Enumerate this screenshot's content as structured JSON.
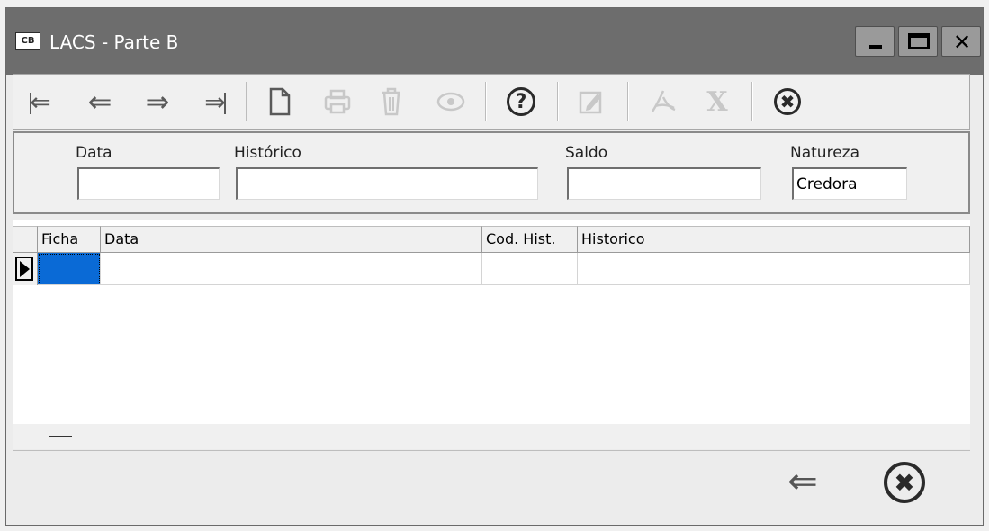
{
  "window": {
    "app_icon_text": "CB",
    "title": "LACS - Parte B",
    "controls": {
      "minimize": "minimize",
      "maximize": "maximize",
      "close_glyph": "✕"
    }
  },
  "toolbar": {
    "buttons": [
      {
        "name": "first-record",
        "icon": "first-arrow-icon",
        "glyph": "⇐",
        "enabled": true
      },
      {
        "name": "previous-record",
        "icon": "left-arrow-icon",
        "glyph": "⇐",
        "enabled": true
      },
      {
        "name": "next-record",
        "icon": "right-arrow-icon",
        "glyph": "⇒",
        "enabled": true
      },
      {
        "name": "last-record",
        "icon": "last-arrow-icon",
        "glyph": "⇒",
        "enabled": true
      },
      {
        "name": "new-record",
        "icon": "new-document-icon",
        "glyph": "🗋",
        "enabled": true
      },
      {
        "name": "print",
        "icon": "printer-icon",
        "glyph": "⎙",
        "enabled": false
      },
      {
        "name": "delete",
        "icon": "trash-icon",
        "glyph": "🗑",
        "enabled": false
      },
      {
        "name": "view",
        "icon": "eye-icon",
        "glyph": "◉",
        "enabled": false
      },
      {
        "name": "help",
        "icon": "help-icon",
        "glyph": "?",
        "enabled": true
      },
      {
        "name": "edit",
        "icon": "edit-icon",
        "glyph": "✎",
        "enabled": false
      },
      {
        "name": "pdf",
        "icon": "pdf-icon",
        "glyph": "⅄",
        "enabled": false
      },
      {
        "name": "excel",
        "icon": "excel-icon",
        "glyph": "X",
        "enabled": false
      },
      {
        "name": "close",
        "icon": "close-circle-icon",
        "glyph": "✖",
        "enabled": true
      }
    ]
  },
  "form": {
    "data_label": "Data",
    "data_value": "",
    "historico_label": "Histórico",
    "historico_value": "",
    "saldo_label": "Saldo",
    "saldo_value": "",
    "natureza_label": "Natureza",
    "natureza_value": "Credora"
  },
  "grid": {
    "columns": [
      "Ficha",
      "Data",
      "Cod. Hist.",
      "Historico"
    ],
    "rows": [
      {
        "ficha": "",
        "data": "",
        "cod_hist": "",
        "historico": ""
      }
    ]
  },
  "footer": {
    "back_glyph": "⇐",
    "close_glyph": "✖"
  }
}
